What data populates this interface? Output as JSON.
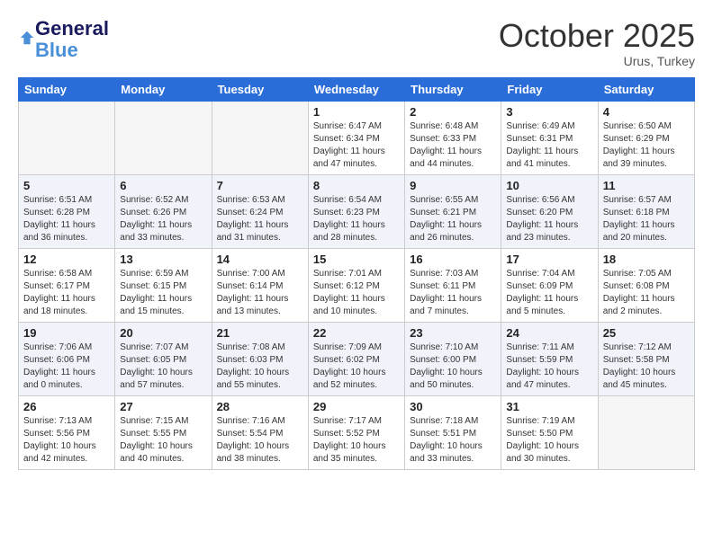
{
  "header": {
    "logo_line1": "General",
    "logo_line2": "Blue",
    "month": "October 2025",
    "location": "Urus, Turkey"
  },
  "days_of_week": [
    "Sunday",
    "Monday",
    "Tuesday",
    "Wednesday",
    "Thursday",
    "Friday",
    "Saturday"
  ],
  "weeks": [
    [
      {
        "day": "",
        "info": ""
      },
      {
        "day": "",
        "info": ""
      },
      {
        "day": "",
        "info": ""
      },
      {
        "day": "1",
        "info": "Sunrise: 6:47 AM\nSunset: 6:34 PM\nDaylight: 11 hours and 47 minutes."
      },
      {
        "day": "2",
        "info": "Sunrise: 6:48 AM\nSunset: 6:33 PM\nDaylight: 11 hours and 44 minutes."
      },
      {
        "day": "3",
        "info": "Sunrise: 6:49 AM\nSunset: 6:31 PM\nDaylight: 11 hours and 41 minutes."
      },
      {
        "day": "4",
        "info": "Sunrise: 6:50 AM\nSunset: 6:29 PM\nDaylight: 11 hours and 39 minutes."
      }
    ],
    [
      {
        "day": "5",
        "info": "Sunrise: 6:51 AM\nSunset: 6:28 PM\nDaylight: 11 hours and 36 minutes."
      },
      {
        "day": "6",
        "info": "Sunrise: 6:52 AM\nSunset: 6:26 PM\nDaylight: 11 hours and 33 minutes."
      },
      {
        "day": "7",
        "info": "Sunrise: 6:53 AM\nSunset: 6:24 PM\nDaylight: 11 hours and 31 minutes."
      },
      {
        "day": "8",
        "info": "Sunrise: 6:54 AM\nSunset: 6:23 PM\nDaylight: 11 hours and 28 minutes."
      },
      {
        "day": "9",
        "info": "Sunrise: 6:55 AM\nSunset: 6:21 PM\nDaylight: 11 hours and 26 minutes."
      },
      {
        "day": "10",
        "info": "Sunrise: 6:56 AM\nSunset: 6:20 PM\nDaylight: 11 hours and 23 minutes."
      },
      {
        "day": "11",
        "info": "Sunrise: 6:57 AM\nSunset: 6:18 PM\nDaylight: 11 hours and 20 minutes."
      }
    ],
    [
      {
        "day": "12",
        "info": "Sunrise: 6:58 AM\nSunset: 6:17 PM\nDaylight: 11 hours and 18 minutes."
      },
      {
        "day": "13",
        "info": "Sunrise: 6:59 AM\nSunset: 6:15 PM\nDaylight: 11 hours and 15 minutes."
      },
      {
        "day": "14",
        "info": "Sunrise: 7:00 AM\nSunset: 6:14 PM\nDaylight: 11 hours and 13 minutes."
      },
      {
        "day": "15",
        "info": "Sunrise: 7:01 AM\nSunset: 6:12 PM\nDaylight: 11 hours and 10 minutes."
      },
      {
        "day": "16",
        "info": "Sunrise: 7:03 AM\nSunset: 6:11 PM\nDaylight: 11 hours and 7 minutes."
      },
      {
        "day": "17",
        "info": "Sunrise: 7:04 AM\nSunset: 6:09 PM\nDaylight: 11 hours and 5 minutes."
      },
      {
        "day": "18",
        "info": "Sunrise: 7:05 AM\nSunset: 6:08 PM\nDaylight: 11 hours and 2 minutes."
      }
    ],
    [
      {
        "day": "19",
        "info": "Sunrise: 7:06 AM\nSunset: 6:06 PM\nDaylight: 11 hours and 0 minutes."
      },
      {
        "day": "20",
        "info": "Sunrise: 7:07 AM\nSunset: 6:05 PM\nDaylight: 10 hours and 57 minutes."
      },
      {
        "day": "21",
        "info": "Sunrise: 7:08 AM\nSunset: 6:03 PM\nDaylight: 10 hours and 55 minutes."
      },
      {
        "day": "22",
        "info": "Sunrise: 7:09 AM\nSunset: 6:02 PM\nDaylight: 10 hours and 52 minutes."
      },
      {
        "day": "23",
        "info": "Sunrise: 7:10 AM\nSunset: 6:00 PM\nDaylight: 10 hours and 50 minutes."
      },
      {
        "day": "24",
        "info": "Sunrise: 7:11 AM\nSunset: 5:59 PM\nDaylight: 10 hours and 47 minutes."
      },
      {
        "day": "25",
        "info": "Sunrise: 7:12 AM\nSunset: 5:58 PM\nDaylight: 10 hours and 45 minutes."
      }
    ],
    [
      {
        "day": "26",
        "info": "Sunrise: 7:13 AM\nSunset: 5:56 PM\nDaylight: 10 hours and 42 minutes."
      },
      {
        "day": "27",
        "info": "Sunrise: 7:15 AM\nSunset: 5:55 PM\nDaylight: 10 hours and 40 minutes."
      },
      {
        "day": "28",
        "info": "Sunrise: 7:16 AM\nSunset: 5:54 PM\nDaylight: 10 hours and 38 minutes."
      },
      {
        "day": "29",
        "info": "Sunrise: 7:17 AM\nSunset: 5:52 PM\nDaylight: 10 hours and 35 minutes."
      },
      {
        "day": "30",
        "info": "Sunrise: 7:18 AM\nSunset: 5:51 PM\nDaylight: 10 hours and 33 minutes."
      },
      {
        "day": "31",
        "info": "Sunrise: 7:19 AM\nSunset: 5:50 PM\nDaylight: 10 hours and 30 minutes."
      },
      {
        "day": "",
        "info": ""
      }
    ]
  ]
}
